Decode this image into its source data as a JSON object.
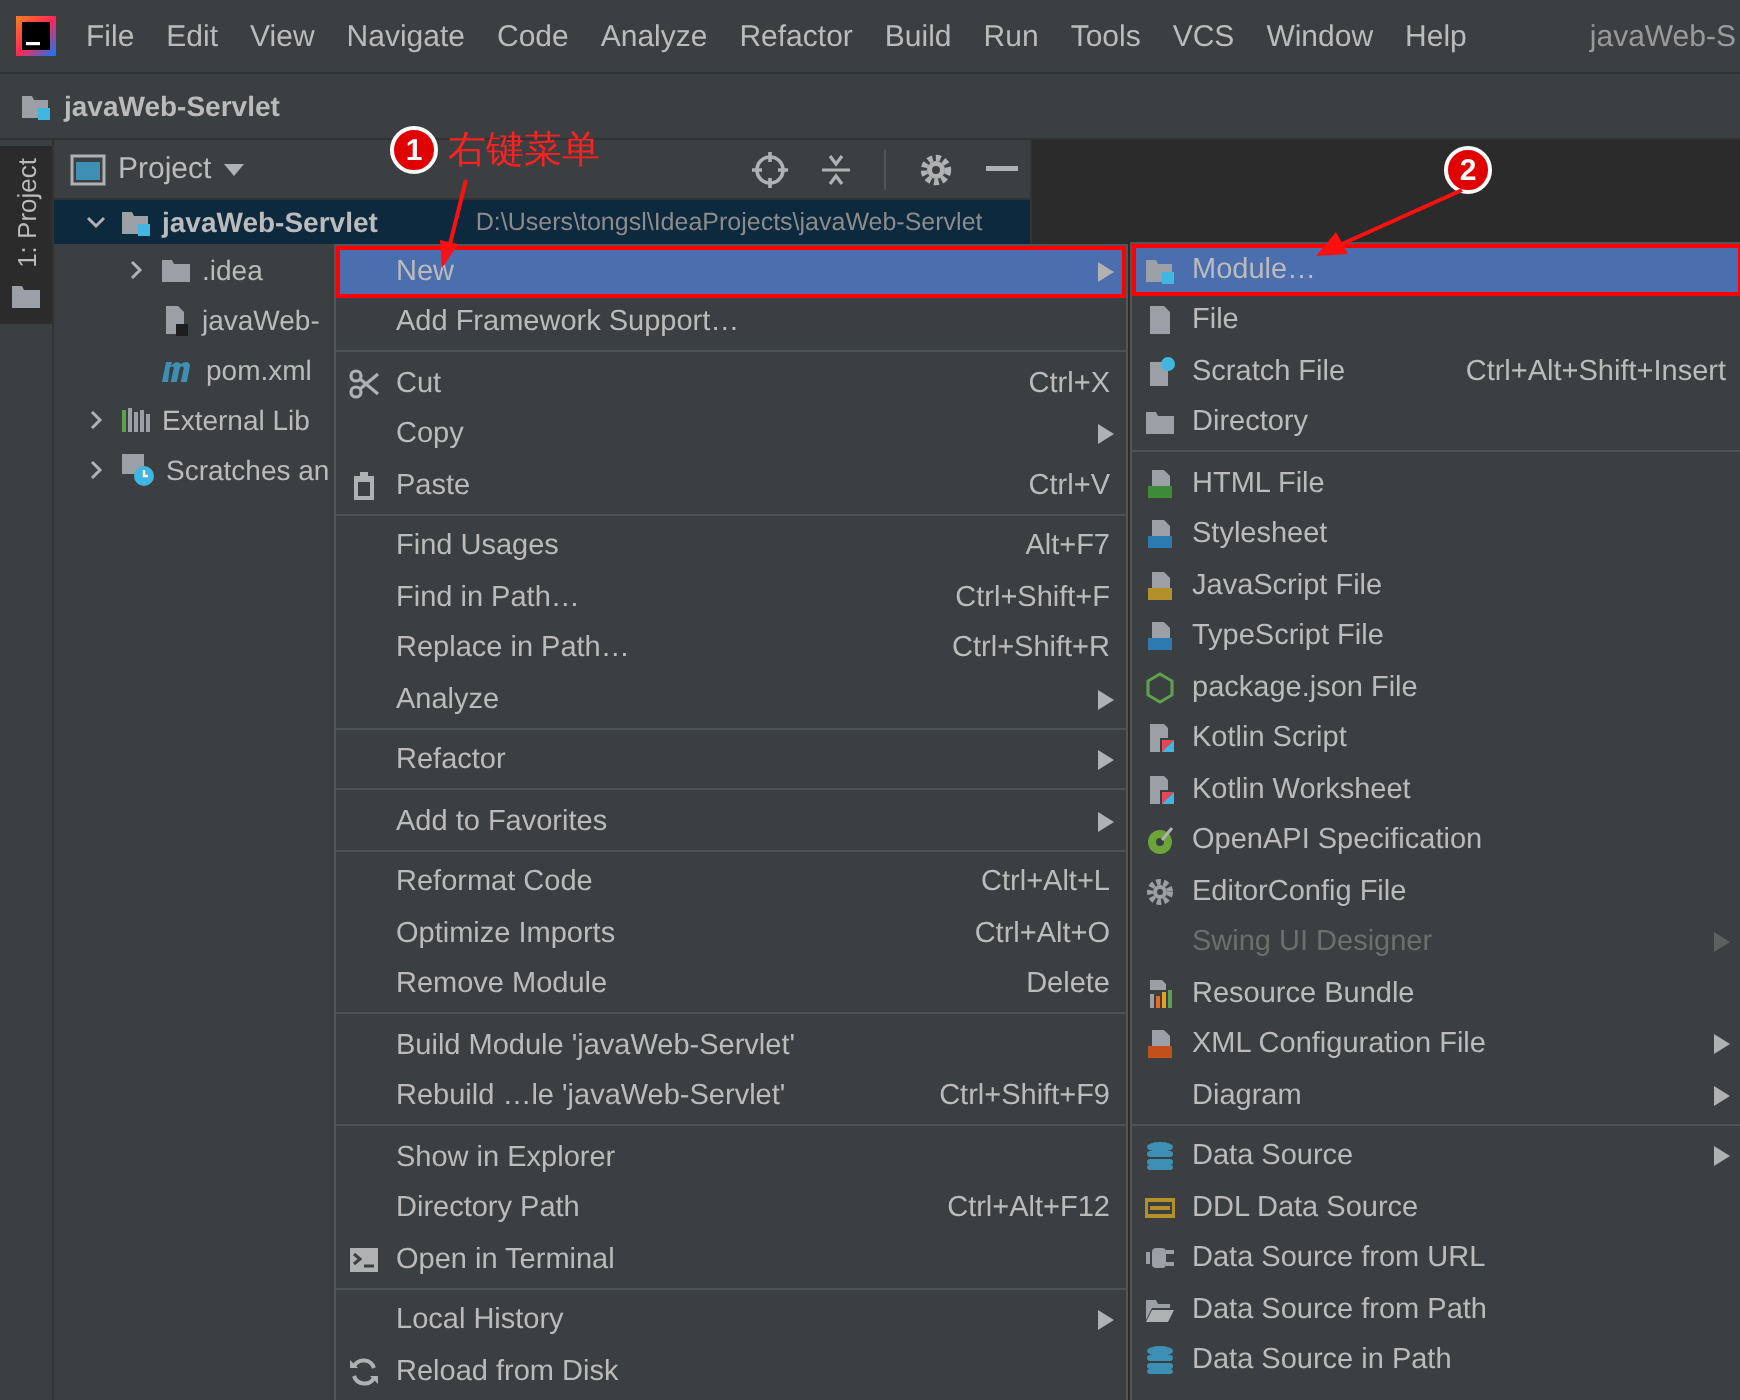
{
  "menubar": {
    "items": [
      {
        "label": "File"
      },
      {
        "label": "Edit"
      },
      {
        "label": "View"
      },
      {
        "label": "Navigate"
      },
      {
        "label": "Code"
      },
      {
        "label": "Analyze"
      },
      {
        "label": "Refactor"
      },
      {
        "label": "Build"
      },
      {
        "label": "Run"
      },
      {
        "label": "Tools"
      },
      {
        "label": "VCS"
      },
      {
        "label": "Window"
      },
      {
        "label": "Help"
      }
    ],
    "title": "javaWeb-S"
  },
  "breadcrumb": {
    "label": "javaWeb-Servlet"
  },
  "tool_strip": {
    "tab": {
      "label": "1: Project",
      "selected": true
    }
  },
  "project_panel": {
    "title": "Project",
    "tree": [
      {
        "label": "javaWeb-Servlet",
        "kind": "module",
        "path": "D:\\Users\\tongsl\\IdeaProjects\\javaWeb-Servlet",
        "expanded": true,
        "selected": true,
        "children": [
          {
            "label": ".idea",
            "kind": "folder",
            "expanded": false,
            "selected": false
          },
          {
            "label": "javaWeb-",
            "kind": "file",
            "selected": false
          },
          {
            "label": "pom.xml",
            "kind": "maven",
            "selected": false
          }
        ]
      },
      {
        "label": "External Lib",
        "kind": "libraries",
        "expanded": false,
        "selected": false
      },
      {
        "label": "Scratches an",
        "kind": "scratches",
        "expanded": false,
        "selected": false
      }
    ]
  },
  "context_menu": {
    "groups": [
      [
        {
          "label": "New",
          "selected": true,
          "outlined": true,
          "submenu": true
        },
        {
          "label": "Add Framework Support…",
          "selected": false
        }
      ],
      [
        {
          "label": "Cut",
          "kind": "cut",
          "shortcut": "Ctrl+X",
          "selected": false
        },
        {
          "label": "Copy",
          "selected": false,
          "submenu": true
        },
        {
          "label": "Paste",
          "kind": "paste",
          "shortcut": "Ctrl+V",
          "selected": false
        }
      ],
      [
        {
          "label": "Find Usages",
          "shortcut": "Alt+F7",
          "selected": false
        },
        {
          "label": "Find in Path…",
          "shortcut": "Ctrl+Shift+F",
          "selected": false
        },
        {
          "label": "Replace in Path…",
          "shortcut": "Ctrl+Shift+R",
          "selected": false
        },
        {
          "label": "Analyze",
          "selected": false,
          "submenu": true
        }
      ],
      [
        {
          "label": "Refactor",
          "selected": false,
          "submenu": true
        }
      ],
      [
        {
          "label": "Add to Favorites",
          "selected": false,
          "submenu": true
        }
      ],
      [
        {
          "label": "Reformat Code",
          "shortcut": "Ctrl+Alt+L",
          "selected": false
        },
        {
          "label": "Optimize Imports",
          "shortcut": "Ctrl+Alt+O",
          "selected": false
        },
        {
          "label": "Remove Module",
          "shortcut": "Delete",
          "selected": false
        }
      ],
      [
        {
          "label": "Build Module 'javaWeb-Servlet'",
          "selected": false
        },
        {
          "label": "Rebuild …le 'javaWeb-Servlet'",
          "shortcut": "Ctrl+Shift+F9",
          "selected": false
        }
      ],
      [
        {
          "label": "Show in Explorer",
          "selected": false
        },
        {
          "label": "Directory Path",
          "shortcut": "Ctrl+Alt+F12",
          "selected": false
        },
        {
          "label": "Open in Terminal",
          "kind": "terminal",
          "selected": false
        }
      ],
      [
        {
          "label": "Local History",
          "selected": false,
          "submenu": true
        },
        {
          "label": "Reload from Disk",
          "kind": "reload",
          "selected": false
        }
      ]
    ]
  },
  "new_submenu": {
    "groups": [
      [
        {
          "label": "Module…",
          "kind": "module",
          "selected": true,
          "outlined": true
        },
        {
          "label": "File",
          "kind": "file",
          "selected": false
        },
        {
          "label": "Scratch File",
          "kind": "scratch",
          "shortcut": "Ctrl+Alt+Shift+Insert",
          "selected": false
        },
        {
          "label": "Directory",
          "kind": "folder",
          "selected": false
        }
      ],
      [
        {
          "label": "HTML File",
          "kind": "html",
          "selected": false
        },
        {
          "label": "Stylesheet",
          "kind": "css",
          "selected": false
        },
        {
          "label": "JavaScript File",
          "kind": "js",
          "selected": false
        },
        {
          "label": "TypeScript File",
          "kind": "ts",
          "selected": false
        },
        {
          "label": "package.json File",
          "kind": "nodejs",
          "selected": false
        },
        {
          "label": "Kotlin Script",
          "kind": "kotlin",
          "selected": false
        },
        {
          "label": "Kotlin Worksheet",
          "kind": "kotlin",
          "selected": false
        },
        {
          "label": "OpenAPI Specification",
          "kind": "openapi",
          "selected": false
        },
        {
          "label": "EditorConfig File",
          "kind": "gear",
          "selected": false
        },
        {
          "label": "Swing UI Designer",
          "selected": false,
          "disabled": true,
          "submenu": true
        },
        {
          "label": "Resource Bundle",
          "kind": "bundle",
          "selected": false
        },
        {
          "label": "XML Configuration File",
          "kind": "xml",
          "selected": false,
          "submenu": true
        },
        {
          "label": "Diagram",
          "selected": false,
          "submenu": true
        }
      ],
      [
        {
          "label": "Data Source",
          "kind": "database",
          "selected": false,
          "submenu": true
        },
        {
          "label": "DDL Data Source",
          "kind": "ddl",
          "selected": false
        },
        {
          "label": "Data Source from URL",
          "kind": "plug",
          "selected": false
        },
        {
          "label": "Data Source from Path",
          "kind": "folder-open",
          "selected": false
        },
        {
          "label": "Data Source in Path",
          "kind": "database",
          "selected": false
        }
      ]
    ]
  },
  "annotations": [
    {
      "number": "1",
      "caption": "右键菜单"
    },
    {
      "number": "2"
    }
  ]
}
